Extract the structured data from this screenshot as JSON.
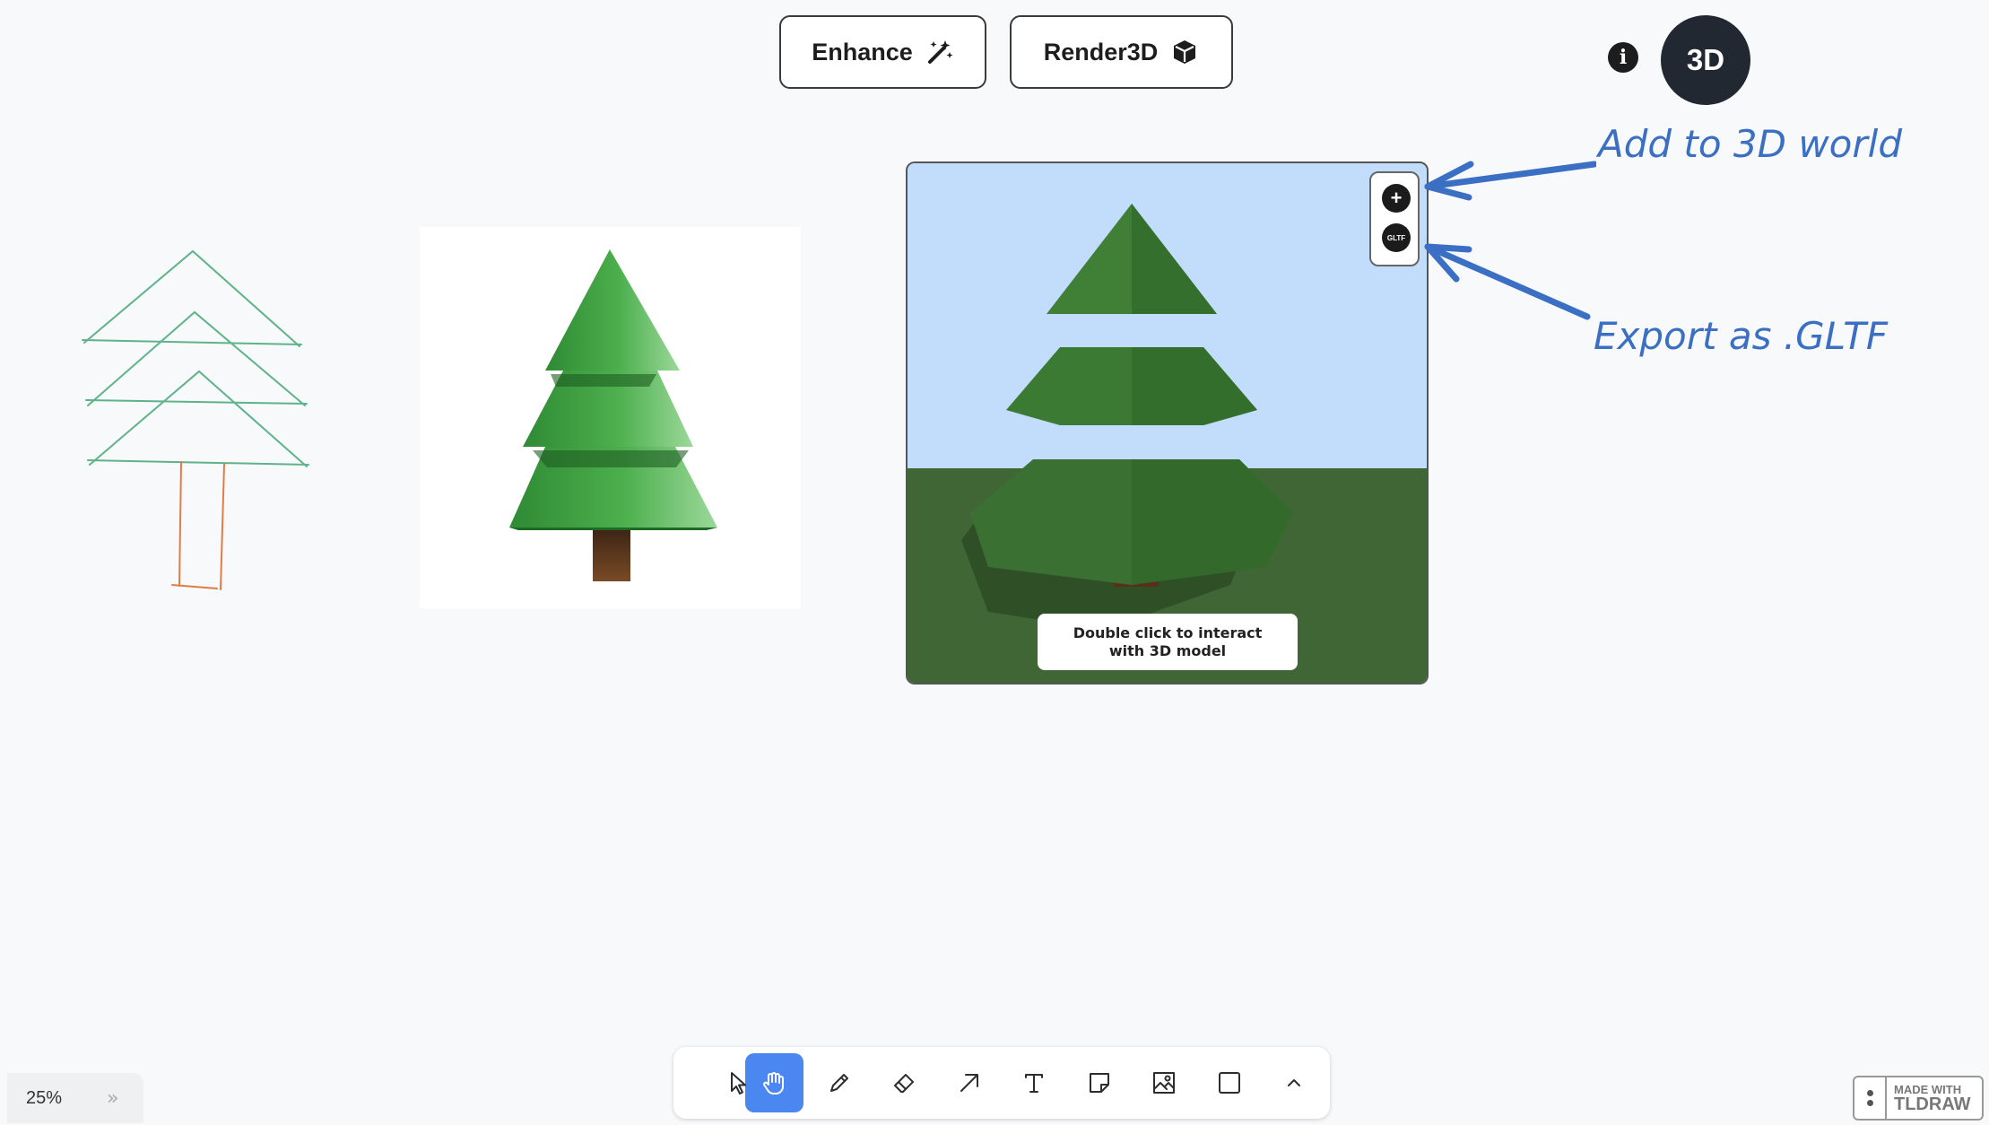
{
  "top_actions": {
    "enhance_label": "Enhance",
    "render3d_label": "Render3D"
  },
  "header_right": {
    "info_label": "i",
    "mode_label": "3D"
  },
  "annotations": {
    "add_world": "Add to 3D world",
    "export_gltf": "Export as .GLTF"
  },
  "viewport": {
    "add_button_label": "+",
    "gltf_button_label": "GLTF",
    "hint": "Double click to interact with 3D model"
  },
  "toolbar": {
    "tools": [
      "select",
      "hand",
      "draw",
      "eraser",
      "arrow",
      "text",
      "note",
      "image",
      "rectangle",
      "more"
    ],
    "active_tool": "hand"
  },
  "footer": {
    "zoom": "25%",
    "expand_label": "»",
    "badge_line1": "MADE WITH",
    "badge_line2": "TLDRAW"
  },
  "colors": {
    "sketch_branches": "#5eb38a",
    "sketch_trunk": "#e07d44",
    "annotation": "#3b6fc4",
    "sky": "#c2dcfb",
    "ground": "#3f6634",
    "active_tool": "#4a87f0"
  }
}
